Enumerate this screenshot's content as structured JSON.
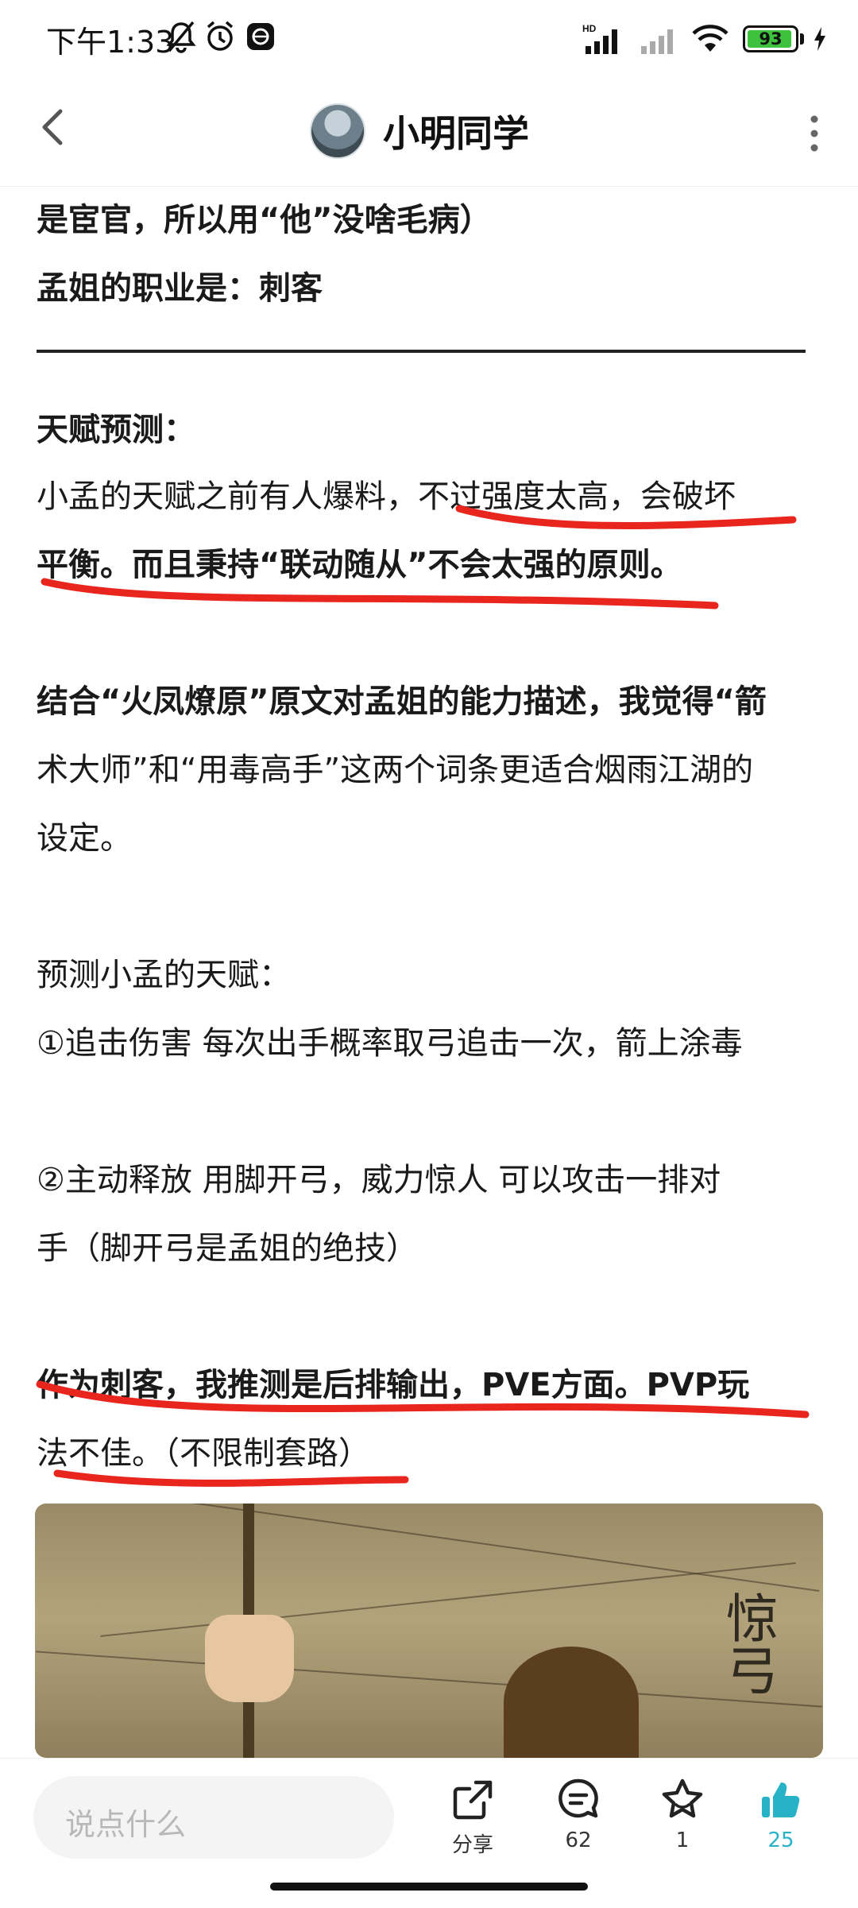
{
  "status_bar": {
    "time": "下午1:33",
    "battery": "93",
    "network_label": "HD"
  },
  "header": {
    "title": "小明同学"
  },
  "article": {
    "lines": [
      "是宦官，所以用“他”没啥毛病）",
      "孟姐的职业是：刺客",
      "天赋预测：",
      "小孟的天赋之前有人爆料，不过强度太高，会破坏",
      "平衡。而且秉持“联动随从”不会太强的原则。",
      "结合“火凤燎原”原文对孟姐的能力描述，我觉得“箭",
      "术大师”和“用毒高手”这两个词条更适合烟雨江湖的",
      "设定。",
      "预测小孟的天赋：",
      "①追击伤害 每次出手概率取弓追击一次，箭上涂毒",
      "②主动释放 用脚开弓，威力惊人 可以攻击一排对",
      "手（脚开弓是孟姐的绝技）",
      "作为刺客，我推测是后排输出，PVE方面。PVP玩",
      "法不佳。（不限制套路）"
    ],
    "image_caption": "惊弓"
  },
  "bottom_bar": {
    "comment_placeholder": "说点什么",
    "share_label": "分享",
    "comment_count": "62",
    "favorite_count": "1",
    "like_count": "25"
  },
  "colors": {
    "accent": "#27b2c8",
    "annotation_red": "#e8261e"
  }
}
